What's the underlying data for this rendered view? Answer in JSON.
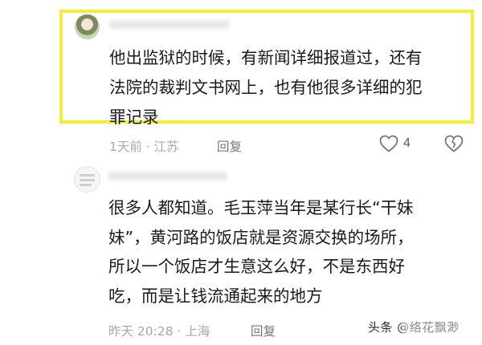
{
  "comments": [
    {
      "text_lines": [
        "他出监狱的时候，有新闻详细报道过，还有",
        "法院的裁判文书网上，也有他很多详细的犯",
        "罪记录"
      ],
      "meta": "1天前 · 江苏",
      "reply_label": "回复",
      "like_count": "4",
      "highlighted": true
    },
    {
      "text_lines": [
        "很多人都知道。毛玉萍当年是某行长“干妹",
        "妹”，黄河路的饭店就是资源交换的场所，",
        "所以一个饭店才生意这么好，不是东西好",
        "吃，而是让钱流通起来的地方"
      ],
      "meta": "昨天 20:28 · 上海",
      "reply_label": "回复"
    }
  ],
  "watermark": "头条 @络花飘渺",
  "icons": {
    "like": "heart-outline-icon",
    "dislike": "broken-heart-icon"
  },
  "colors": {
    "highlight_border": "#f4ec3a",
    "text": "#1a1a1a",
    "meta": "#a8a8a8"
  }
}
